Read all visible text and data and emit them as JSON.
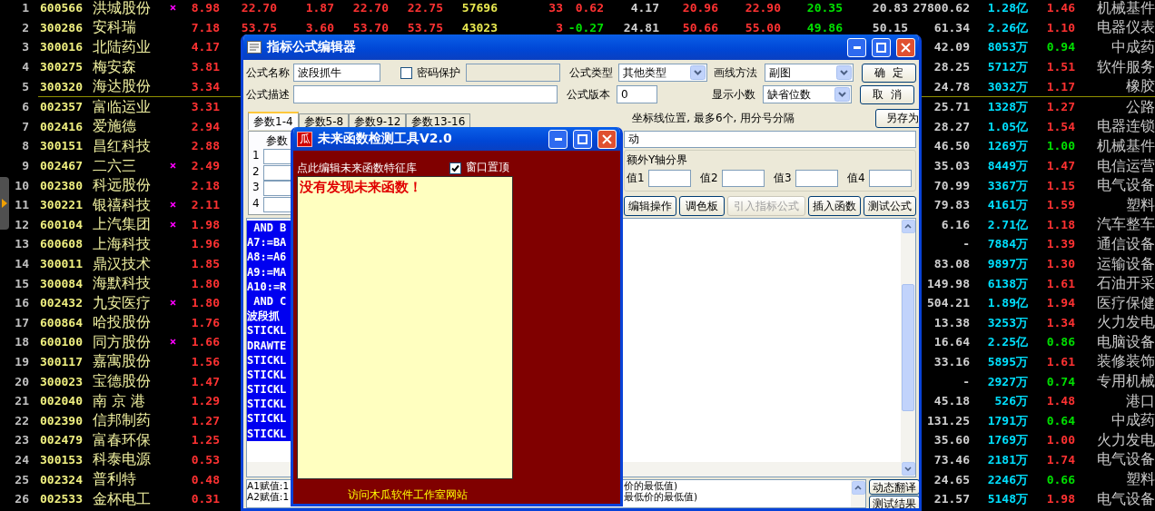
{
  "quotes": {
    "groups": [
      [
        {
          "index": "1",
          "code": "600566",
          "name": "洪城股份",
          "marked": true,
          "change": "8.98",
          "middle": [
            {
              "text": "22.70",
              "color": "#ff3232"
            },
            {
              "text": "1.87",
              "color": "#ff3232"
            },
            {
              "text": "22.70",
              "color": "#ff3232"
            },
            {
              "text": "22.75",
              "color": "#ff3232"
            },
            {
              "text": "57696",
              "color": "#e8e850"
            },
            {
              "text": "33",
              "color": "#ff3232"
            },
            {
              "text": "0.62",
              "color": "#ff3232"
            },
            {
              "text": "4.17",
              "color": "#d0d0d0"
            },
            {
              "text": "20.96",
              "color": "#ff3232"
            },
            {
              "text": "22.90",
              "color": "#ff3232"
            },
            {
              "text": "20.35",
              "color": "#00e000"
            },
            {
              "text": "20.83",
              "color": "#d0d0d0"
            }
          ],
          "right": [
            {
              "text": "27800.62",
              "color": "#d0d0d0"
            },
            {
              "text": "1.28亿",
              "color": "#00e0ff"
            },
            {
              "text": "1.46",
              "color": "#ff3232"
            },
            {
              "text": "机械基件",
              "color": "#c8c8c8"
            }
          ]
        },
        {
          "index": "2",
          "code": "300286",
          "name": "安科瑞",
          "marked": false,
          "change": "7.18",
          "middle": [
            {
              "text": "53.75",
              "color": "#ff3232"
            },
            {
              "text": "3.60",
              "color": "#ff3232"
            },
            {
              "text": "53.70",
              "color": "#ff3232"
            },
            {
              "text": "53.75",
              "color": "#ff3232"
            },
            {
              "text": "43023",
              "color": "#e8e850"
            },
            {
              "text": "3",
              "color": "#ff3232"
            },
            {
              "text": "-0.27",
              "color": "#00e000"
            },
            {
              "text": "24.81",
              "color": "#d0d0d0"
            },
            {
              "text": "50.66",
              "color": "#ff3232"
            },
            {
              "text": "55.00",
              "color": "#ff3232"
            },
            {
              "text": "49.86",
              "color": "#00e000"
            },
            {
              "text": "50.15",
              "color": "#d0d0d0"
            }
          ],
          "right": [
            {
              "text": "61.34",
              "color": "#d0d0d0"
            },
            {
              "text": "2.26亿",
              "color": "#00e0ff"
            },
            {
              "text": "1.10",
              "color": "#ff3232"
            },
            {
              "text": "电器仪表",
              "color": "#c8c8c8"
            }
          ]
        },
        {
          "index": "3",
          "code": "300016",
          "name": "北陆药业",
          "marked": false,
          "change": "4.17",
          "right": [
            {
              "text": "42.09",
              "color": "#d0d0d0"
            },
            {
              "text": "8053万",
              "color": "#00e0ff"
            },
            {
              "text": "0.94",
              "color": "#00e000"
            },
            {
              "text": "中成药",
              "color": "#c8c8c8"
            }
          ]
        },
        {
          "index": "4",
          "code": "300275",
          "name": "梅安森",
          "marked": false,
          "change": "3.81",
          "right": [
            {
              "text": "28.25",
              "color": "#d0d0d0"
            },
            {
              "text": "5712万",
              "color": "#00e0ff"
            },
            {
              "text": "1.51",
              "color": "#ff3232"
            },
            {
              "text": "软件服务",
              "color": "#c8c8c8"
            }
          ]
        },
        {
          "index": "5",
          "code": "300320",
          "name": "海达股份",
          "marked": false,
          "change": "3.34",
          "right": [
            {
              "text": "24.78",
              "color": "#d0d0d0"
            },
            {
              "text": "3032万",
              "color": "#00e0ff"
            },
            {
              "text": "1.17",
              "color": "#ff3232"
            },
            {
              "text": "橡胶",
              "color": "#c8c8c8"
            }
          ]
        }
      ],
      [
        {
          "index": "6",
          "code": "002357",
          "name": "富临运业",
          "marked": false,
          "change": "3.31",
          "right": [
            {
              "text": "25.71",
              "color": "#d0d0d0"
            },
            {
              "text": "1328万",
              "color": "#00e0ff"
            },
            {
              "text": "1.27",
              "color": "#ff3232"
            },
            {
              "text": "公路",
              "color": "#c8c8c8"
            }
          ]
        },
        {
          "index": "7",
          "code": "002416",
          "name": "爱施德",
          "marked": false,
          "change": "2.94",
          "right": [
            {
              "text": "28.27",
              "color": "#d0d0d0"
            },
            {
              "text": "1.05亿",
              "color": "#00e0ff"
            },
            {
              "text": "1.54",
              "color": "#ff3232"
            },
            {
              "text": "电器连锁",
              "color": "#c8c8c8"
            }
          ]
        },
        {
          "index": "8",
          "code": "300151",
          "name": "昌红科技",
          "marked": false,
          "change": "2.88",
          "right": [
            {
              "text": "46.50",
              "color": "#d0d0d0"
            },
            {
              "text": "1269万",
              "color": "#00e0ff"
            },
            {
              "text": "1.00",
              "color": "#00e000"
            },
            {
              "text": "机械基件",
              "color": "#c8c8c8"
            }
          ]
        },
        {
          "index": "9",
          "code": "002467",
          "name": "二六三",
          "marked": true,
          "change": "2.49",
          "right": [
            {
              "text": "35.03",
              "color": "#d0d0d0"
            },
            {
              "text": "8449万",
              "color": "#00e0ff"
            },
            {
              "text": "1.47",
              "color": "#ff3232"
            },
            {
              "text": "电信运营",
              "color": "#c8c8c8"
            }
          ]
        },
        {
          "index": "10",
          "code": "002380",
          "name": "科远股份",
          "marked": false,
          "change": "2.18",
          "right": [
            {
              "text": "70.99",
              "color": "#d0d0d0"
            },
            {
              "text": "3367万",
              "color": "#00e0ff"
            },
            {
              "text": "1.15",
              "color": "#ff3232"
            },
            {
              "text": "电气设备",
              "color": "#c8c8c8"
            }
          ]
        },
        {
          "index": "11",
          "code": "300221",
          "name": "银禧科技",
          "marked": true,
          "change": "2.11",
          "right": [
            {
              "text": "79.83",
              "color": "#d0d0d0"
            },
            {
              "text": "4161万",
              "color": "#00e0ff"
            },
            {
              "text": "1.59",
              "color": "#ff3232"
            },
            {
              "text": "塑料",
              "color": "#c8c8c8"
            }
          ]
        },
        {
          "index": "12",
          "code": "600104",
          "name": "上汽集团",
          "marked": true,
          "change": "1.98",
          "right": [
            {
              "text": "6.16",
              "color": "#d0d0d0"
            },
            {
              "text": "2.71亿",
              "color": "#00e0ff"
            },
            {
              "text": "1.18",
              "color": "#ff3232"
            },
            {
              "text": "汽车整车",
              "color": "#c8c8c8"
            }
          ]
        },
        {
          "index": "13",
          "code": "600608",
          "name": "上海科技",
          "marked": false,
          "change": "1.96",
          "right": [
            {
              "text": "-",
              "color": "#d0d0d0"
            },
            {
              "text": "7884万",
              "color": "#00e0ff"
            },
            {
              "text": "1.39",
              "color": "#ff3232"
            },
            {
              "text": "通信设备",
              "color": "#c8c8c8"
            }
          ]
        },
        {
          "index": "14",
          "code": "300011",
          "name": "鼎汉技术",
          "marked": false,
          "change": "1.85",
          "right": [
            {
              "text": "83.08",
              "color": "#d0d0d0"
            },
            {
              "text": "9897万",
              "color": "#00e0ff"
            },
            {
              "text": "1.30",
              "color": "#ff3232"
            },
            {
              "text": "运输设备",
              "color": "#c8c8c8"
            }
          ]
        },
        {
          "index": "15",
          "code": "300084",
          "name": "海默科技",
          "marked": false,
          "change": "1.80",
          "right": [
            {
              "text": "149.98",
              "color": "#d0d0d0"
            },
            {
              "text": "6138万",
              "color": "#00e0ff"
            },
            {
              "text": "1.61",
              "color": "#ff3232"
            },
            {
              "text": "石油开采",
              "color": "#c8c8c8"
            }
          ]
        },
        {
          "index": "16",
          "code": "002432",
          "name": "九安医疗",
          "marked": true,
          "change": "1.80",
          "right": [
            {
              "text": "504.21",
              "color": "#d0d0d0"
            },
            {
              "text": "1.89亿",
              "color": "#00e0ff"
            },
            {
              "text": "1.94",
              "color": "#ff3232"
            },
            {
              "text": "医疗保健",
              "color": "#c8c8c8"
            }
          ]
        },
        {
          "index": "17",
          "code": "600864",
          "name": "哈投股份",
          "marked": false,
          "change": "1.76",
          "right": [
            {
              "text": "13.38",
              "color": "#d0d0d0"
            },
            {
              "text": "3253万",
              "color": "#00e0ff"
            },
            {
              "text": "1.34",
              "color": "#ff3232"
            },
            {
              "text": "火力发电",
              "color": "#c8c8c8"
            }
          ]
        },
        {
          "index": "18",
          "code": "600100",
          "name": "同方股份",
          "marked": true,
          "change": "1.66",
          "right": [
            {
              "text": "16.64",
              "color": "#d0d0d0"
            },
            {
              "text": "2.25亿",
              "color": "#00e0ff"
            },
            {
              "text": "0.86",
              "color": "#00e000"
            },
            {
              "text": "电脑设备",
              "color": "#c8c8c8"
            }
          ]
        },
        {
          "index": "19",
          "code": "300117",
          "name": "嘉寓股份",
          "marked": false,
          "change": "1.56",
          "right": [
            {
              "text": "33.16",
              "color": "#d0d0d0"
            },
            {
              "text": "5895万",
              "color": "#00e0ff"
            },
            {
              "text": "1.61",
              "color": "#ff3232"
            },
            {
              "text": "装修装饰",
              "color": "#c8c8c8"
            }
          ]
        },
        {
          "index": "20",
          "code": "300023",
          "name": "宝德股份",
          "marked": false,
          "change": "1.47",
          "right": [
            {
              "text": "-",
              "color": "#d0d0d0"
            },
            {
              "text": "2927万",
              "color": "#00e0ff"
            },
            {
              "text": "0.74",
              "color": "#00e000"
            },
            {
              "text": "专用机械",
              "color": "#c8c8c8"
            }
          ]
        },
        {
          "index": "21",
          "code": "002040",
          "name": "南 京 港",
          "marked": false,
          "change": "1.29",
          "right": [
            {
              "text": "45.18",
              "color": "#d0d0d0"
            },
            {
              "text": "526万",
              "color": "#00e0ff"
            },
            {
              "text": "1.48",
              "color": "#ff3232"
            },
            {
              "text": "港口",
              "color": "#c8c8c8"
            }
          ]
        },
        {
          "index": "22",
          "code": "002390",
          "name": "信邦制药",
          "marked": false,
          "change": "1.27",
          "right": [
            {
              "text": "131.25",
              "color": "#d0d0d0"
            },
            {
              "text": "1791万",
              "color": "#00e0ff"
            },
            {
              "text": "0.64",
              "color": "#00e000"
            },
            {
              "text": "中成药",
              "color": "#c8c8c8"
            }
          ]
        },
        {
          "index": "23",
          "code": "002479",
          "name": "富春环保",
          "marked": false,
          "change": "1.25",
          "right": [
            {
              "text": "35.60",
              "color": "#d0d0d0"
            },
            {
              "text": "1769万",
              "color": "#00e0ff"
            },
            {
              "text": "1.00",
              "color": "#ff3232"
            },
            {
              "text": "火力发电",
              "color": "#c8c8c8"
            }
          ]
        },
        {
          "index": "24",
          "code": "300153",
          "name": "科泰电源",
          "marked": false,
          "change": "0.53",
          "right": [
            {
              "text": "73.46",
              "color": "#d0d0d0"
            },
            {
              "text": "2181万",
              "color": "#00e0ff"
            },
            {
              "text": "1.74",
              "color": "#ff3232"
            },
            {
              "text": "电气设备",
              "color": "#c8c8c8"
            }
          ]
        },
        {
          "index": "25",
          "code": "002324",
          "name": "普利特",
          "marked": false,
          "change": "0.48",
          "right": [
            {
              "text": "24.65",
              "color": "#d0d0d0"
            },
            {
              "text": "2246万",
              "color": "#00e0ff"
            },
            {
              "text": "0.66",
              "color": "#00e000"
            },
            {
              "text": "塑料",
              "color": "#c8c8c8"
            }
          ]
        },
        {
          "index": "26",
          "code": "002533",
          "name": "金杯电工",
          "marked": false,
          "change": "0.31",
          "right": [
            {
              "text": "21.57",
              "color": "#d0d0d0"
            },
            {
              "text": "5148万",
              "color": "#00e0ff"
            },
            {
              "text": "1.98",
              "color": "#ff3232"
            },
            {
              "text": "电气设备",
              "color": "#c8c8c8"
            }
          ]
        }
      ]
    ]
  },
  "editor": {
    "title": "指标公式编辑器",
    "name_label": "公式名称",
    "name_value": "波段抓牛",
    "password": {
      "label": "密码保护",
      "checked": false
    },
    "type_label": "公式类型",
    "type_value": "其他类型",
    "draw_label": "画线方法",
    "draw_value": "副图",
    "desc_label": "公式描述",
    "version_label": "公式版本",
    "version_value": "0",
    "decimals_label": "显示小数",
    "decimals_value": "缺省位数",
    "side_buttons": [
      "确  定",
      "取  消",
      "另存为"
    ],
    "tabs": [
      {
        "label": "参数1-4",
        "selected": true
      },
      {
        "label": "参数5-8",
        "selected": false
      },
      {
        "label": "参数9-12",
        "selected": false
      },
      {
        "label": "参数13-16",
        "selected": false
      }
    ],
    "param_header": "参数",
    "param_rows": [
      "1",
      "2",
      "3",
      "4"
    ],
    "axis_label": "坐标线位置, 最多6个, 用分号分隔",
    "axis_value": "动",
    "yaxis_group": "额外Y轴分界",
    "yaxis_fields": [
      "值1",
      "值2",
      "值3",
      "值4"
    ],
    "actions": [
      {
        "label": "编辑操作",
        "disabled": false
      },
      {
        "label": "调色板",
        "disabled": false
      },
      {
        "label": "引入指标公式",
        "disabled": true
      },
      {
        "label": "插入函数",
        "disabled": false
      },
      {
        "label": "测试公式",
        "disabled": false
      }
    ],
    "code_lines": [
      " AND B",
      "A7:=BA",
      "A8:=A6",
      "A9:=MA",
      "A10:=R",
      " AND C",
      "波段抓",
      "STICKL",
      "DRAWTE",
      "STICKL",
      "STICKL",
      "STICKL",
      "STICKL",
      "STICKL",
      "STICKL"
    ],
    "messages_left": [
      "A1赋值:1",
      "A2赋值:1"
    ],
    "messages_right": [
      "价的最低值)",
      "最低价的最低值)"
    ],
    "bottom_buttons": [
      "动态翻译",
      "测试结果"
    ]
  },
  "dialog": {
    "title": "未来函数检测工具V2.0",
    "logo": "瓜",
    "edit_link": "点此编辑未来函数特征库",
    "on_top": {
      "label": "窗口置顶",
      "checked": true
    },
    "result": "没有发现未来函数！",
    "site_link": "访问木瓜软件工作室网站"
  }
}
